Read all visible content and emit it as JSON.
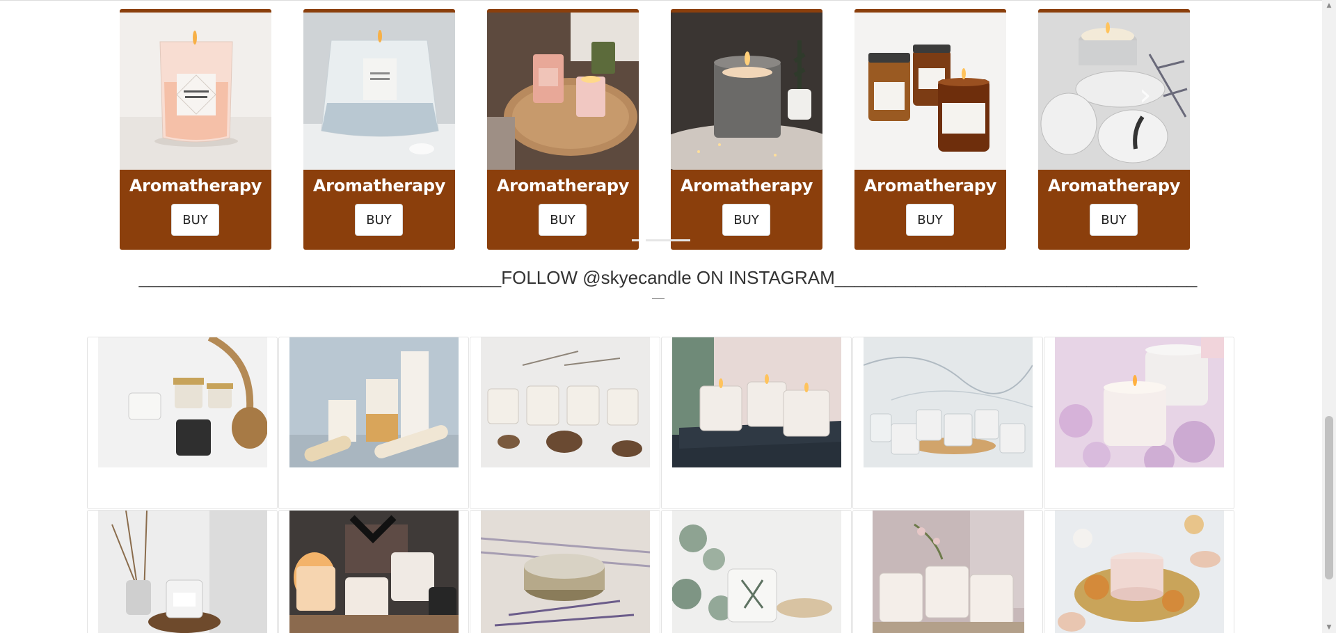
{
  "products": [
    {
      "title": "Aromatherapy",
      "buy_label": "BUY",
      "image": "candle-lait-de-coco"
    },
    {
      "title": "Aromatherapy",
      "buy_label": "BUY",
      "image": "candle-pure-linen"
    },
    {
      "title": "Aromatherapy",
      "buy_label": "BUY",
      "image": "candle-happy-space-tray"
    },
    {
      "title": "Aromatherapy",
      "buy_label": "BUY",
      "image": "candle-glass-fur"
    },
    {
      "title": "Aromatherapy",
      "buy_label": "BUY",
      "image": "candle-amber-jars"
    },
    {
      "title": "Aromatherapy",
      "buy_label": "BUY",
      "image": "candle-tins-lavender"
    }
  ],
  "carousel": {
    "prev_icon": "chevron-left-icon",
    "next_icon": "chevron-right-icon",
    "prev_glyph": "‹",
    "next_glyph": "›",
    "dot_count": 2,
    "active_dot": 0
  },
  "instagram": {
    "heading": "____________________________________FOLLOW @skyecandle ON INSTAGRAM____________________________________"
  },
  "gallery": {
    "rows": 2,
    "columns": 6,
    "images": [
      "jars-rattan",
      "pillar-candles-gold",
      "jars-pinecones",
      "candles-dark-books",
      "jars-marble-board",
      "white-candle-flowers",
      "jar-diffuser",
      "gift-box-candles",
      "tin-lavender",
      "jar-eucalyptus",
      "jars-linen-flowers",
      "pillar-dried-citrus"
    ]
  },
  "colors": {
    "card_brown": "#8b3f0c",
    "text_dark": "#333333",
    "page_bg": "#ffffff"
  },
  "scrollbar": {
    "up_glyph": "▲",
    "down_glyph": "▼"
  }
}
